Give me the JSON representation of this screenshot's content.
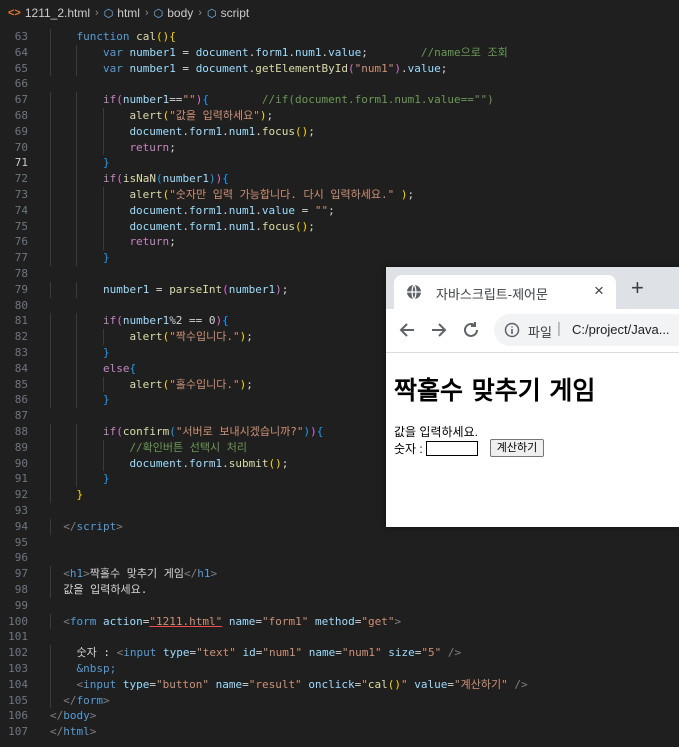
{
  "breadcrumb": {
    "file": "1211_2.html",
    "items": [
      "html",
      "body",
      "script"
    ],
    "file_icon": "html-file-icon",
    "element_icon": "cube-icon"
  },
  "editor": {
    "active_line": 71,
    "lines": [
      {
        "n": 63,
        "indent": 4,
        "parts": [
          [
            "k",
            "function "
          ],
          [
            "f",
            "cal"
          ],
          [
            "b1",
            "(){"
          ]
        ]
      },
      {
        "n": 64,
        "indent": 8,
        "parts": [
          [
            "k",
            "var "
          ],
          [
            "v",
            "number1"
          ],
          [
            "p",
            " = "
          ],
          [
            "v",
            "document"
          ],
          [
            "p",
            "."
          ],
          [
            "v",
            "form1"
          ],
          [
            "p",
            "."
          ],
          [
            "v",
            "num1"
          ],
          [
            "p",
            "."
          ],
          [
            "v",
            "value"
          ],
          [
            "p",
            ";        "
          ],
          [
            "c",
            "//name으로 조회"
          ]
        ]
      },
      {
        "n": 65,
        "indent": 8,
        "parts": [
          [
            "k",
            "var "
          ],
          [
            "v",
            "number1"
          ],
          [
            "p",
            " = "
          ],
          [
            "v",
            "document"
          ],
          [
            "p",
            "."
          ],
          [
            "f",
            "getElementById"
          ],
          [
            "b2",
            "("
          ],
          [
            "s",
            "\"num1\""
          ],
          [
            "b2",
            ")"
          ],
          [
            "p",
            "."
          ],
          [
            "v",
            "value"
          ],
          [
            "p",
            ";"
          ]
        ]
      },
      {
        "n": 66,
        "indent": 0,
        "parts": []
      },
      {
        "n": 67,
        "indent": 8,
        "parts": [
          [
            "ctl",
            "if"
          ],
          [
            "b2",
            "("
          ],
          [
            "v",
            "number1"
          ],
          [
            "p",
            "=="
          ],
          [
            "s",
            "\"\""
          ],
          [
            "b2",
            ")"
          ],
          [
            "b3",
            "{"
          ],
          [
            "p",
            "        "
          ],
          [
            "c",
            "//if(document.form1.num1.value==\"\")"
          ]
        ]
      },
      {
        "n": 68,
        "indent": 12,
        "parts": [
          [
            "f",
            "alert"
          ],
          [
            "b1",
            "("
          ],
          [
            "s",
            "\"값을 입력하세요\""
          ],
          [
            "b1",
            ")"
          ],
          [
            "p",
            ";"
          ]
        ]
      },
      {
        "n": 69,
        "indent": 12,
        "parts": [
          [
            "v",
            "document"
          ],
          [
            "p",
            "."
          ],
          [
            "v",
            "form1"
          ],
          [
            "p",
            "."
          ],
          [
            "v",
            "num1"
          ],
          [
            "p",
            "."
          ],
          [
            "f",
            "focus"
          ],
          [
            "b1",
            "()"
          ],
          [
            "p",
            ";"
          ]
        ]
      },
      {
        "n": 70,
        "indent": 12,
        "parts": [
          [
            "ctl",
            "return"
          ],
          [
            "p",
            ";"
          ]
        ]
      },
      {
        "n": 71,
        "indent": 8,
        "parts": [
          [
            "b3",
            "}"
          ]
        ]
      },
      {
        "n": 72,
        "indent": 8,
        "parts": [
          [
            "ctl",
            "if"
          ],
          [
            "b2",
            "("
          ],
          [
            "f",
            "isNaN"
          ],
          [
            "b3",
            "("
          ],
          [
            "v",
            "number1"
          ],
          [
            "b3",
            ")"
          ],
          [
            "b2",
            ")"
          ],
          [
            "b3",
            "{"
          ]
        ]
      },
      {
        "n": 73,
        "indent": 12,
        "parts": [
          [
            "f",
            "alert"
          ],
          [
            "b1",
            "("
          ],
          [
            "s",
            "\"숫자만 입력 가능합니다. 다시 입력하세요.\""
          ],
          [
            "p",
            " "
          ],
          [
            "b1",
            ")"
          ],
          [
            "p",
            ";"
          ]
        ]
      },
      {
        "n": 74,
        "indent": 12,
        "parts": [
          [
            "v",
            "document"
          ],
          [
            "p",
            "."
          ],
          [
            "v",
            "form1"
          ],
          [
            "p",
            "."
          ],
          [
            "v",
            "num1"
          ],
          [
            "p",
            "."
          ],
          [
            "v",
            "value"
          ],
          [
            "p",
            " = "
          ],
          [
            "s",
            "\"\""
          ],
          [
            "p",
            ";"
          ]
        ]
      },
      {
        "n": 75,
        "indent": 12,
        "parts": [
          [
            "v",
            "document"
          ],
          [
            "p",
            "."
          ],
          [
            "v",
            "form1"
          ],
          [
            "p",
            "."
          ],
          [
            "v",
            "num1"
          ],
          [
            "p",
            "."
          ],
          [
            "f",
            "focus"
          ],
          [
            "b1",
            "()"
          ],
          [
            "p",
            ";"
          ]
        ]
      },
      {
        "n": 76,
        "indent": 12,
        "parts": [
          [
            "ctl",
            "return"
          ],
          [
            "p",
            ";"
          ]
        ]
      },
      {
        "n": 77,
        "indent": 8,
        "parts": [
          [
            "b3",
            "}"
          ]
        ]
      },
      {
        "n": 78,
        "indent": 0,
        "parts": []
      },
      {
        "n": 79,
        "indent": 8,
        "parts": [
          [
            "v",
            "number1"
          ],
          [
            "p",
            " = "
          ],
          [
            "f",
            "parseInt"
          ],
          [
            "b2",
            "("
          ],
          [
            "v",
            "number1"
          ],
          [
            "b2",
            ")"
          ],
          [
            "p",
            ";"
          ]
        ]
      },
      {
        "n": 80,
        "indent": 0,
        "parts": []
      },
      {
        "n": 81,
        "indent": 8,
        "parts": [
          [
            "ctl",
            "if"
          ],
          [
            "b2",
            "("
          ],
          [
            "v",
            "number1"
          ],
          [
            "p",
            "%2 == 0"
          ],
          [
            "b2",
            ")"
          ],
          [
            "b3",
            "{"
          ]
        ]
      },
      {
        "n": 82,
        "indent": 12,
        "parts": [
          [
            "f",
            "alert"
          ],
          [
            "b1",
            "("
          ],
          [
            "s",
            "\"짝수입니다.\""
          ],
          [
            "b1",
            ")"
          ],
          [
            "p",
            ";"
          ]
        ]
      },
      {
        "n": 83,
        "indent": 8,
        "parts": [
          [
            "b3",
            "}"
          ]
        ]
      },
      {
        "n": 84,
        "indent": 8,
        "parts": [
          [
            "ctl",
            "else"
          ],
          [
            "b3",
            "{"
          ]
        ]
      },
      {
        "n": 85,
        "indent": 12,
        "parts": [
          [
            "f",
            "alert"
          ],
          [
            "b1",
            "("
          ],
          [
            "s",
            "\"홀수입니다.\""
          ],
          [
            "b1",
            ")"
          ],
          [
            "p",
            ";"
          ]
        ]
      },
      {
        "n": 86,
        "indent": 8,
        "parts": [
          [
            "b3",
            "}"
          ]
        ]
      },
      {
        "n": 87,
        "indent": 0,
        "parts": []
      },
      {
        "n": 88,
        "indent": 8,
        "parts": [
          [
            "ctl",
            "if"
          ],
          [
            "b2",
            "("
          ],
          [
            "f",
            "confirm"
          ],
          [
            "b3",
            "("
          ],
          [
            "s",
            "\"서버로 보내시겠습니까?\""
          ],
          [
            "b3",
            ")"
          ],
          [
            "b2",
            ")"
          ],
          [
            "b3",
            "{"
          ]
        ]
      },
      {
        "n": 89,
        "indent": 12,
        "parts": [
          [
            "c",
            "//확인버튼 선택시 처리"
          ]
        ]
      },
      {
        "n": 90,
        "indent": 12,
        "parts": [
          [
            "v",
            "document"
          ],
          [
            "p",
            "."
          ],
          [
            "v",
            "form1"
          ],
          [
            "p",
            "."
          ],
          [
            "f",
            "submit"
          ],
          [
            "b1",
            "()"
          ],
          [
            "p",
            ";"
          ]
        ]
      },
      {
        "n": 91,
        "indent": 8,
        "parts": [
          [
            "b3",
            "}"
          ]
        ]
      },
      {
        "n": 92,
        "indent": 4,
        "parts": [
          [
            "b1",
            "}"
          ]
        ]
      },
      {
        "n": 93,
        "indent": 0,
        "parts": []
      },
      {
        "n": 94,
        "indent": 2,
        "parts": [
          [
            "t",
            "</"
          ],
          [
            "tn",
            "script"
          ],
          [
            "t",
            ">"
          ]
        ]
      },
      {
        "n": 95,
        "indent": 0,
        "parts": []
      },
      {
        "n": 96,
        "indent": 0,
        "parts": []
      },
      {
        "n": 97,
        "indent": 2,
        "parts": [
          [
            "t",
            "<"
          ],
          [
            "tn",
            "h1"
          ],
          [
            "t",
            ">"
          ],
          [
            "p",
            "짝홀수 맞추기 게임"
          ],
          [
            "t",
            "</"
          ],
          [
            "tn",
            "h1"
          ],
          [
            "t",
            ">"
          ]
        ]
      },
      {
        "n": 98,
        "indent": 2,
        "parts": [
          [
            "p",
            "값을 입력하세요."
          ]
        ]
      },
      {
        "n": 99,
        "indent": 0,
        "parts": []
      },
      {
        "n": 100,
        "indent": 2,
        "parts": [
          [
            "t",
            "<"
          ],
          [
            "tn",
            "form "
          ],
          [
            "a",
            "action"
          ],
          [
            "p",
            "="
          ],
          [
            "su",
            "\"1211.html\""
          ],
          [
            "p",
            " "
          ],
          [
            "a",
            "name"
          ],
          [
            "p",
            "="
          ],
          [
            "s",
            "\"form1\""
          ],
          [
            "p",
            " "
          ],
          [
            "a",
            "method"
          ],
          [
            "p",
            "="
          ],
          [
            "s",
            "\"get\""
          ],
          [
            "t",
            ">"
          ]
        ]
      },
      {
        "n": 101,
        "indent": 0,
        "parts": []
      },
      {
        "n": 102,
        "indent": 4,
        "parts": [
          [
            "p",
            "숫자 : "
          ],
          [
            "t",
            "<"
          ],
          [
            "tn",
            "input "
          ],
          [
            "a",
            "type"
          ],
          [
            "p",
            "="
          ],
          [
            "s",
            "\"text\""
          ],
          [
            "p",
            " "
          ],
          [
            "a",
            "id"
          ],
          [
            "p",
            "="
          ],
          [
            "s",
            "\"num1\""
          ],
          [
            "p",
            " "
          ],
          [
            "a",
            "name"
          ],
          [
            "p",
            "="
          ],
          [
            "s",
            "\"num1\""
          ],
          [
            "p",
            " "
          ],
          [
            "a",
            "size"
          ],
          [
            "p",
            "="
          ],
          [
            "s",
            "\"5\""
          ],
          [
            "p",
            " "
          ],
          [
            "t",
            "/>"
          ]
        ]
      },
      {
        "n": 103,
        "indent": 4,
        "parts": [
          [
            "k",
            "&nbsp;"
          ]
        ]
      },
      {
        "n": 104,
        "indent": 4,
        "parts": [
          [
            "t",
            "<"
          ],
          [
            "tn",
            "input "
          ],
          [
            "a",
            "type"
          ],
          [
            "p",
            "="
          ],
          [
            "s",
            "\"button\""
          ],
          [
            "p",
            " "
          ],
          [
            "a",
            "name"
          ],
          [
            "p",
            "="
          ],
          [
            "s",
            "\"result\""
          ],
          [
            "p",
            " "
          ],
          [
            "a",
            "onclick"
          ],
          [
            "p",
            "="
          ],
          [
            "s",
            "\""
          ],
          [
            "f",
            "cal"
          ],
          [
            "b1",
            "()"
          ],
          [
            "s",
            "\""
          ],
          [
            "p",
            " "
          ],
          [
            "a",
            "value"
          ],
          [
            "p",
            "="
          ],
          [
            "s",
            "\"계산하기\""
          ],
          [
            "p",
            " "
          ],
          [
            "t",
            "/>"
          ]
        ]
      },
      {
        "n": 105,
        "indent": 2,
        "parts": [
          [
            "t",
            "</"
          ],
          [
            "tn",
            "form"
          ],
          [
            "t",
            ">"
          ]
        ]
      },
      {
        "n": 106,
        "indent": 0,
        "parts": [
          [
            "t",
            "</"
          ],
          [
            "tn",
            "body"
          ],
          [
            "t",
            ">"
          ]
        ]
      },
      {
        "n": 107,
        "indent": 0,
        "parts": [
          [
            "t",
            "</"
          ],
          [
            "tn",
            "html"
          ],
          [
            "t",
            ">"
          ]
        ]
      }
    ]
  },
  "browser": {
    "tab_title": "자바스크립트-제어문",
    "tab_close": "×",
    "new_tab": "+",
    "scheme_label": "파일",
    "separator": "|",
    "url": "C:/project/Java...",
    "page": {
      "heading": "짝홀수 맞추기 게임",
      "prompt": "값을 입력하세요.",
      "number_label": "숫자 :",
      "number_value": "",
      "button_label": "계산하기"
    }
  }
}
